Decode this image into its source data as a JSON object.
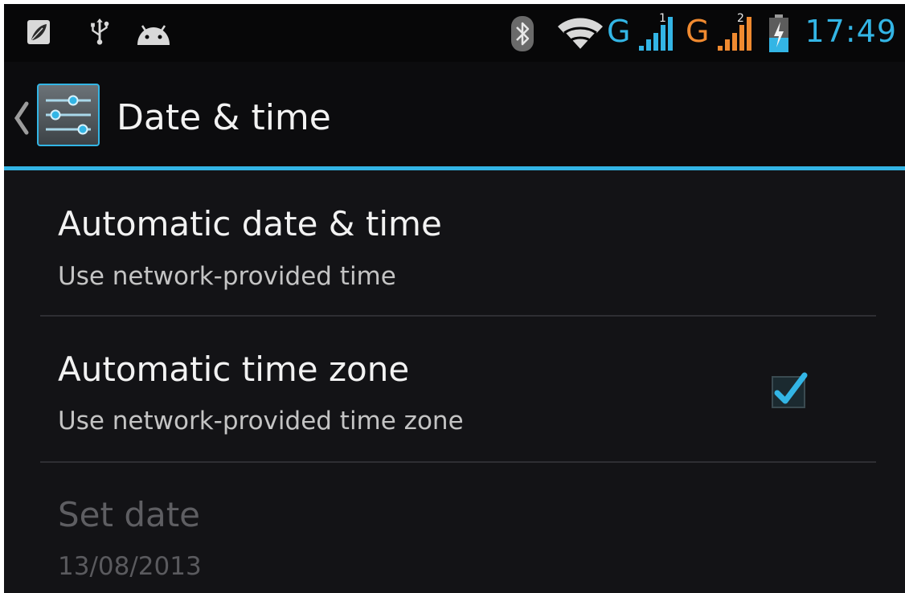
{
  "status_bar": {
    "left_icons": [
      "leaf-icon",
      "usb-icon",
      "android-icon"
    ],
    "right_icons": [
      "bluetooth-icon",
      "wifi-icon",
      "signal-icon",
      "signal-icon",
      "battery-charging-icon"
    ],
    "network_1": "G",
    "network_1_sim": "1",
    "network_2": "G",
    "network_2_sim": "2",
    "clock": "17:49",
    "colors": {
      "network_1": "#33b5e5",
      "network_2": "#f08a30",
      "clock": "#33b5e5"
    }
  },
  "action_bar": {
    "title": "Date & time",
    "up_icon": "chevron-left-icon",
    "app_icon": "settings-sliders-icon",
    "accent": "#33b5e5"
  },
  "preferences": [
    {
      "title": "Automatic date & time",
      "summary": "Use network-provided time",
      "enabled": true
    },
    {
      "title": "Automatic time zone",
      "summary": "Use network-provided time zone",
      "enabled": true,
      "checked": true
    },
    {
      "title": "Set date",
      "summary": "13/08/2013",
      "enabled": false
    }
  ]
}
